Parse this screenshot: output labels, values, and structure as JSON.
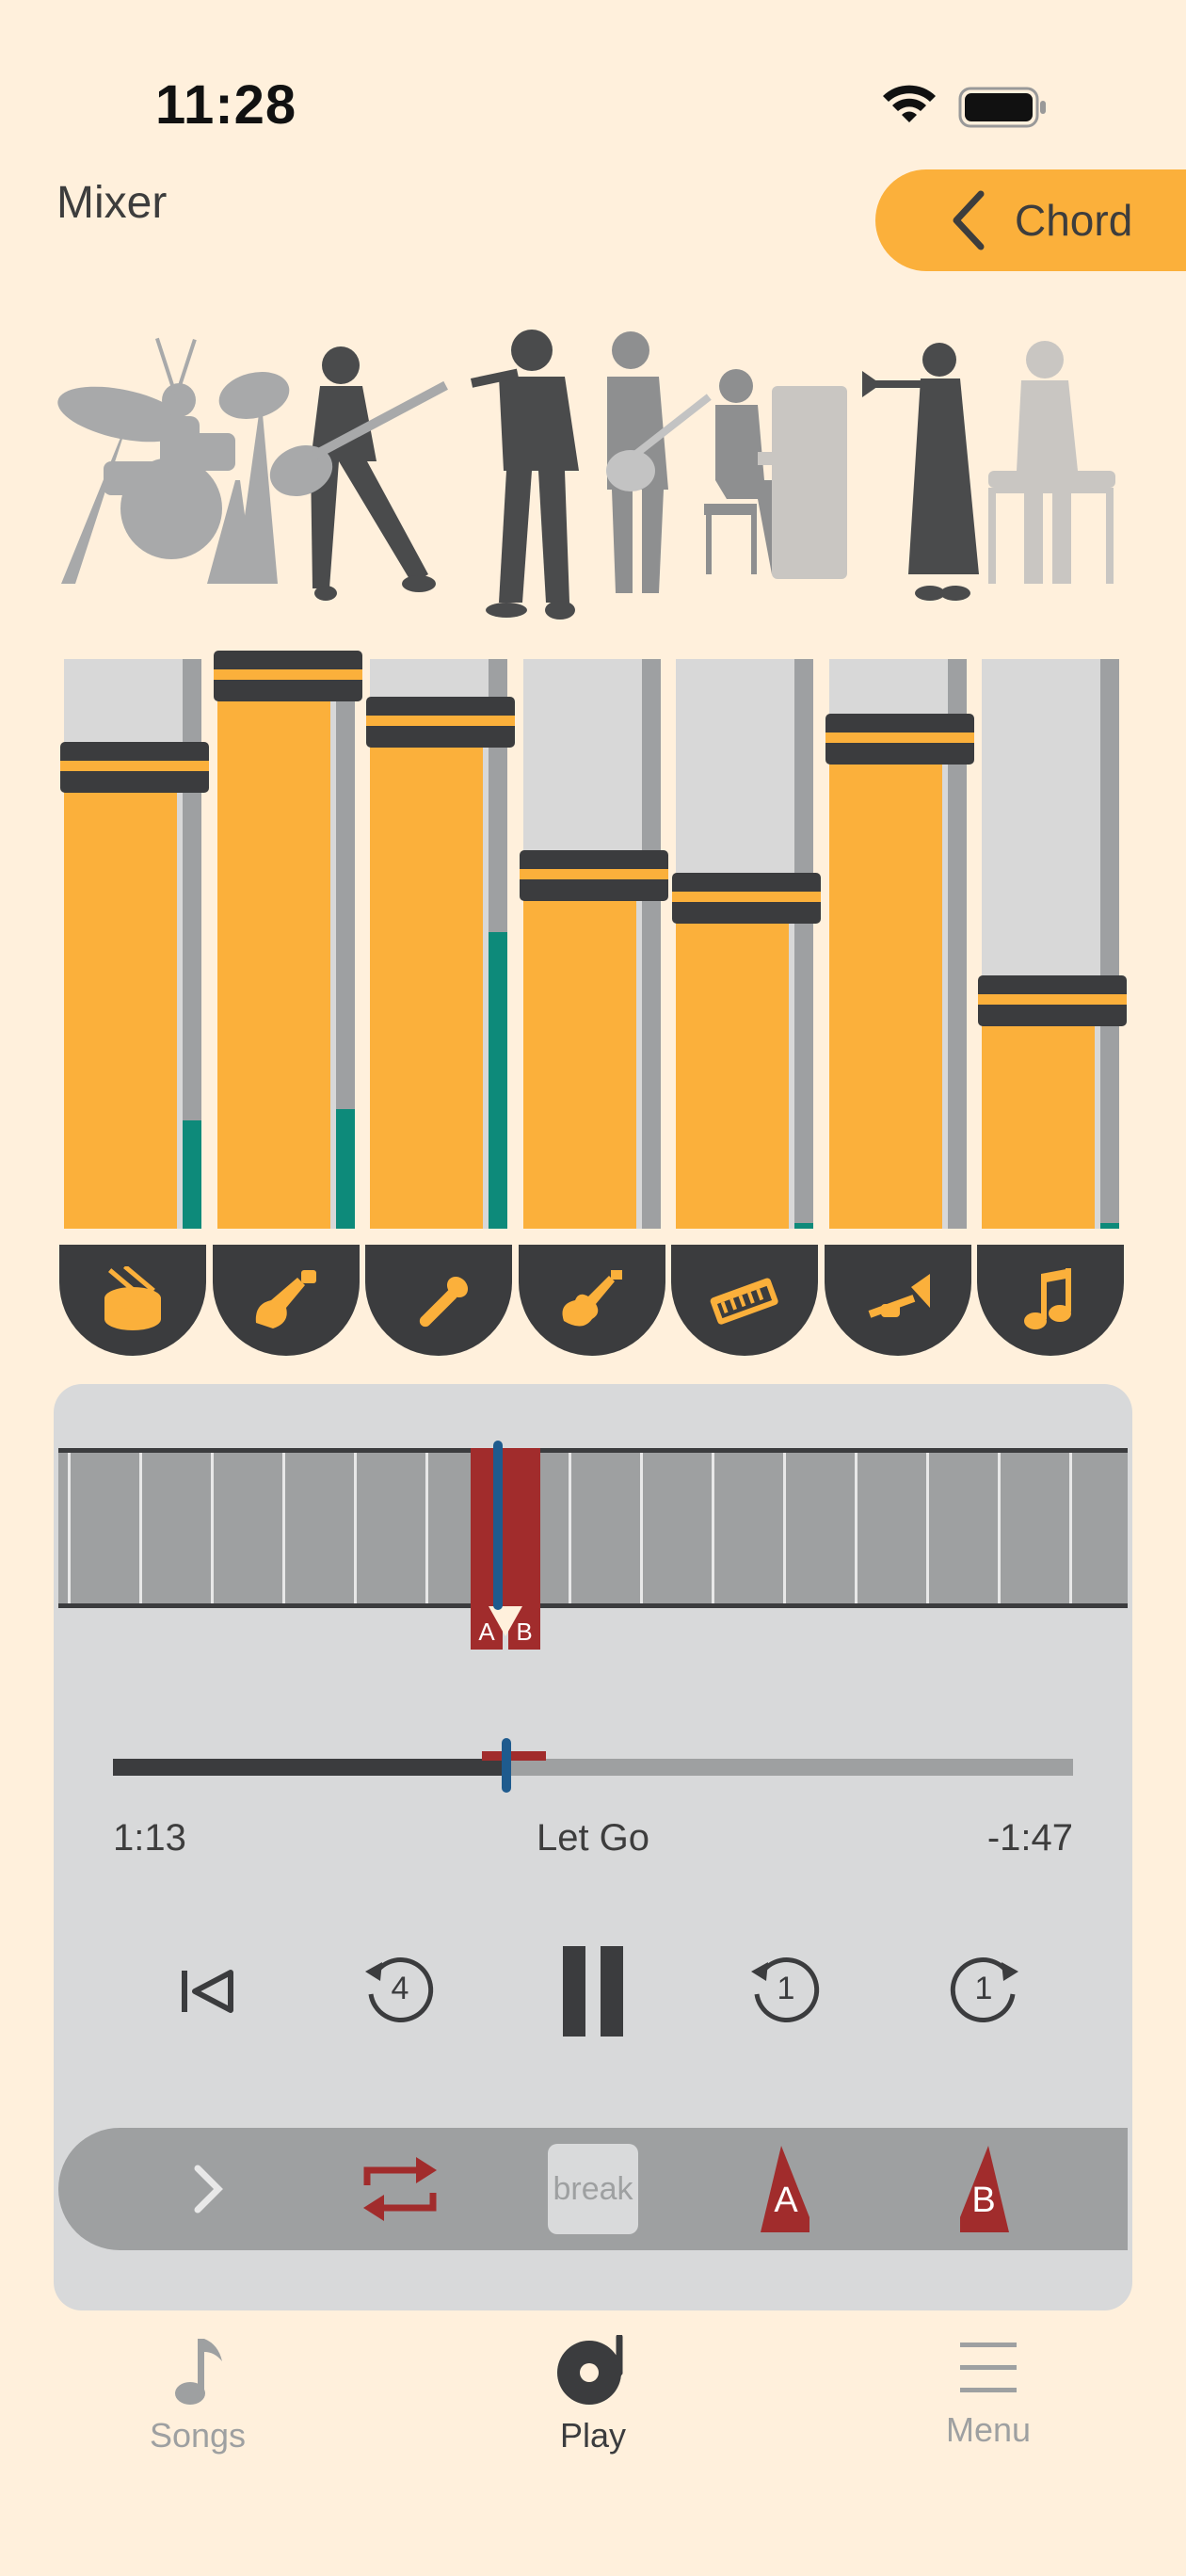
{
  "status_bar": {
    "time": "11:28"
  },
  "header": {
    "title": "Mixer",
    "chord_button_label": "Chord"
  },
  "band": {
    "members": [
      "drummer",
      "bassist",
      "vocalist",
      "guitarist",
      "pianist",
      "trumpeter",
      "keyboardist"
    ]
  },
  "mixer": {
    "channels": [
      {
        "name": "drums",
        "icon": "drum-icon",
        "volume": 0.81,
        "meter": 0.19
      },
      {
        "name": "bass",
        "icon": "bass-guitar-icon",
        "volume": 0.97,
        "meter": 0.21
      },
      {
        "name": "vocal",
        "icon": "microphone-icon",
        "volume": 0.89,
        "meter": 0.52
      },
      {
        "name": "guitar",
        "icon": "electric-guitar-icon",
        "volume": 0.62,
        "meter": 0.0
      },
      {
        "name": "keyboard",
        "icon": "keyboard-icon",
        "volume": 0.58,
        "meter": 0.01
      },
      {
        "name": "trumpet",
        "icon": "trumpet-icon",
        "volume": 0.86,
        "meter": 0.0
      },
      {
        "name": "other",
        "icon": "music-note-icon",
        "volume": 0.4,
        "meter": 0.01
      }
    ],
    "colors": {
      "fader": "#fbb03b",
      "meter_active": "#0d8a7a",
      "knob": "#3b3c3e"
    }
  },
  "player": {
    "loop_a_label": "A",
    "loop_b_label": "B",
    "progress": 0.41,
    "elapsed": "1:13",
    "song_title": "Let Go",
    "remaining": "-1:47",
    "rewind_4_label": "4",
    "rewind_1_label": "1",
    "forward_1_label": "1",
    "break_label": "break",
    "set_a_label": "A",
    "set_b_label": "B"
  },
  "tabs": [
    {
      "label": "Songs",
      "active": false
    },
    {
      "label": "Play",
      "active": true
    },
    {
      "label": "Menu",
      "active": false
    }
  ]
}
